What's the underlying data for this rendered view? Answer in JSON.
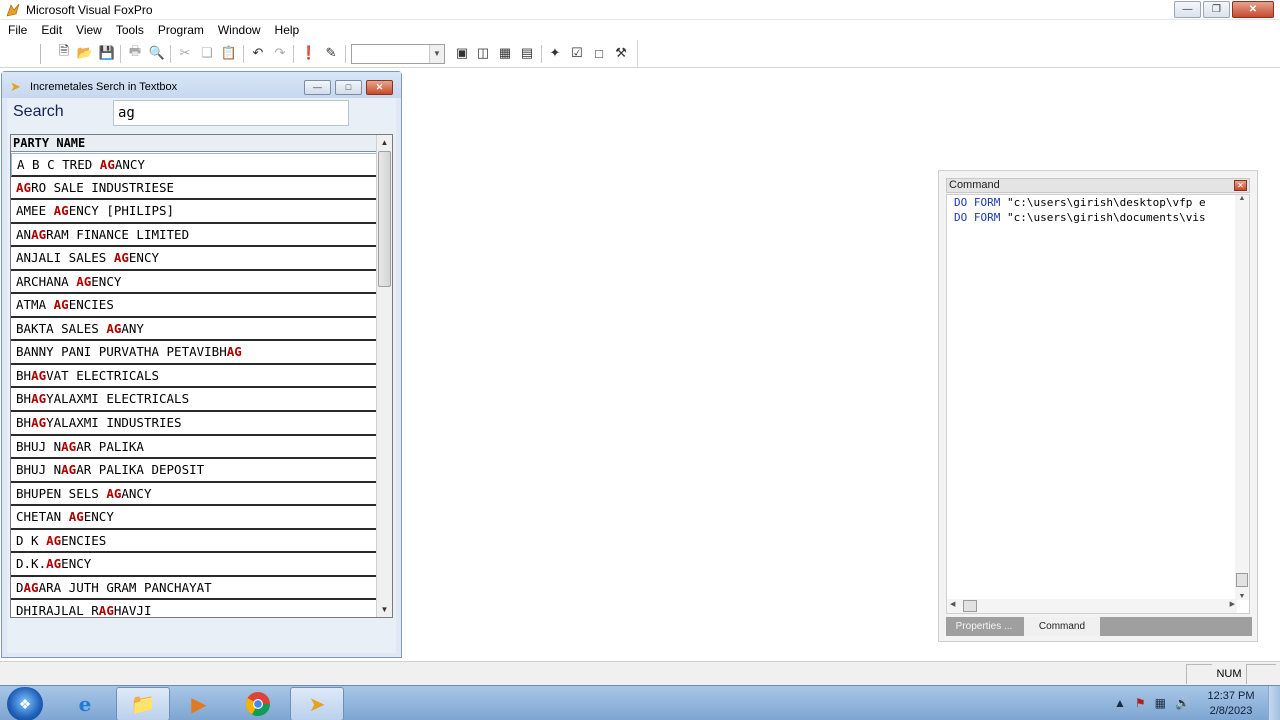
{
  "app": {
    "title": "Microsoft Visual FoxPro"
  },
  "menubar": {
    "items": [
      "File",
      "Edit",
      "View",
      "Tools",
      "Program",
      "Window",
      "Help"
    ]
  },
  "toolbar": {
    "icons": [
      "new-file-icon",
      "open-folder-icon",
      "save-icon",
      "print-icon",
      "print-preview-icon",
      "cut-icon",
      "copy-icon",
      "paste-icon",
      "undo-icon",
      "redo-icon",
      "run-icon",
      "modify-form-icon",
      "command-window-icon",
      "data-session-icon",
      "properties-icon",
      "code-icon",
      "form-wizard-icon",
      "report-designer-icon",
      "builder-icon"
    ],
    "combo_value": ""
  },
  "form": {
    "title": "Incremetales Serch in Textbox",
    "search_label": "Search",
    "search_value": "ag",
    "grid": {
      "column_header": "PARTY NAME",
      "highlight_color": "#b00000",
      "rows": [
        {
          "pre": "A B C TRED ",
          "match": "AG",
          "post": "ANCY"
        },
        {
          "pre": "",
          "match": "AG",
          "post": "RO SALE INDUSTRIESE"
        },
        {
          "pre": "AMEE ",
          "match": "AG",
          "post": "ENCY [PHILIPS]"
        },
        {
          "pre": "AN",
          "match": "AG",
          "post": "RAM FINANCE LIMITED"
        },
        {
          "pre": "ANJALI SALES ",
          "match": "AG",
          "post": "ENCY"
        },
        {
          "pre": "ARCHANA ",
          "match": "AG",
          "post": "ENCY"
        },
        {
          "pre": "ATMA ",
          "match": "AG",
          "post": "ENCIES"
        },
        {
          "pre": "BAKTA SALES ",
          "match": "AG",
          "post": "ANY"
        },
        {
          "pre": "BANNY PANI PURVATHA PETAVIBH",
          "match": "AG",
          "post": ""
        },
        {
          "pre": "BH",
          "match": "AG",
          "post": "VAT ELECTRICALS"
        },
        {
          "pre": "BH",
          "match": "AG",
          "post": "YALAXMI ELECTRICALS"
        },
        {
          "pre": "BH",
          "match": "AG",
          "post": "YALAXMI INDUSTRIES"
        },
        {
          "pre": "BHUJ N",
          "match": "AG",
          "post": "AR PALIKA"
        },
        {
          "pre": "BHUJ N",
          "match": "AG",
          "post": "AR PALIKA DEPOSIT"
        },
        {
          "pre": "BHUPEN SELS ",
          "match": "AG",
          "post": "ANCY"
        },
        {
          "pre": "CHETAN ",
          "match": "AG",
          "post": "ENCY"
        },
        {
          "pre": "D K ",
          "match": "AG",
          "post": "ENCIES"
        },
        {
          "pre": "D.K.",
          "match": "AG",
          "post": "ENCY"
        },
        {
          "pre": "D",
          "match": "AG",
          "post": "ARA JUTH GRAM PANCHAYAT"
        },
        {
          "pre": "DHIRAJLAL R",
          "match": "AG",
          "post": "HAVJI"
        }
      ]
    }
  },
  "command_window": {
    "title": "Command",
    "lines": [
      {
        "kw": "DO FORM",
        "arg": " \"c:\\users\\girish\\desktop\\vfp e"
      },
      {
        "kw": "DO FORM",
        "arg": " \"c:\\users\\girish\\documents\\vis"
      }
    ],
    "tabs": [
      "Properties ...",
      "Command"
    ]
  },
  "statusbar": {
    "num": "NUM"
  },
  "taskbar": {
    "apps": [
      "internet-explorer-icon",
      "file-explorer-icon",
      "media-player-icon",
      "chrome-icon",
      "visual-foxpro-icon"
    ],
    "clock_time": "12:37 PM",
    "clock_date": "2/8/2023"
  }
}
